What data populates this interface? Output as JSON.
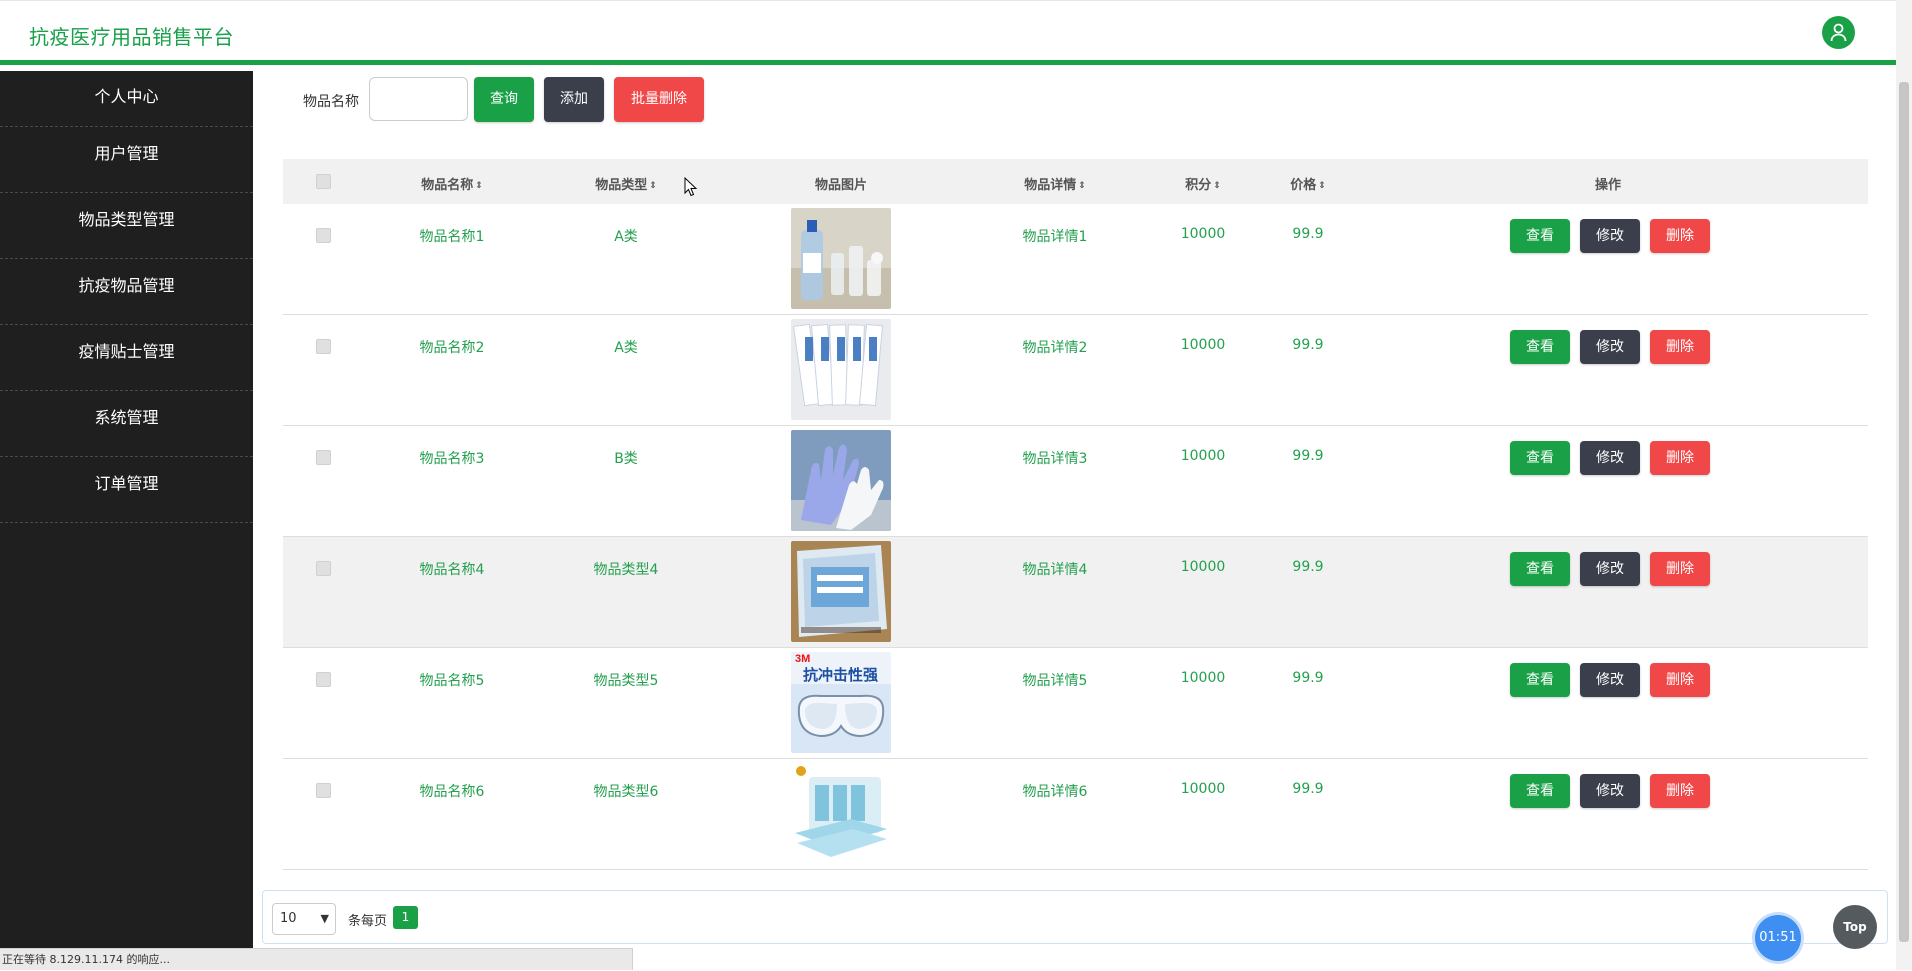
{
  "header": {
    "title": "抗疫医疗用品销售平台"
  },
  "sidebar": {
    "items": [
      {
        "label": "个人中心"
      },
      {
        "label": "用户管理"
      },
      {
        "label": "物品类型管理"
      },
      {
        "label": "抗疫物品管理"
      },
      {
        "label": "疫情贴士管理"
      },
      {
        "label": "系统管理"
      },
      {
        "label": "订单管理"
      }
    ]
  },
  "toolbar": {
    "search_label": "物品名称",
    "search_value": "",
    "query_label": "查询",
    "add_label": "添加",
    "batch_delete_label": "批量删除"
  },
  "table": {
    "columns": [
      "物品名称",
      "物品类型",
      "物品图片",
      "物品详情",
      "积分",
      "价格",
      "操作"
    ],
    "rows": [
      {
        "name": "物品名称1",
        "type": "A类",
        "detail": "物品详情1",
        "points": "10000",
        "price": "99.9",
        "image": "hand-sanitizer-image"
      },
      {
        "name": "物品名称2",
        "type": "A类",
        "detail": "物品详情2",
        "points": "10000",
        "price": "99.9",
        "image": "swab-packets-image"
      },
      {
        "name": "物品名称3",
        "type": "B类",
        "detail": "物品详情3",
        "points": "10000",
        "price": "99.9",
        "image": "gloves-image"
      },
      {
        "name": "物品名称4",
        "type": "物品类型4",
        "detail": "物品详情4",
        "points": "10000",
        "price": "99.9",
        "image": "bagged-masks-image"
      },
      {
        "name": "物品名称5",
        "type": "物品类型5",
        "detail": "物品详情5",
        "points": "10000",
        "price": "99.9",
        "image": "goggles-image"
      },
      {
        "name": "物品名称6",
        "type": "物品类型6",
        "detail": "物品详情6",
        "points": "10000",
        "price": "99.9",
        "image": "surgical-masks-image"
      }
    ],
    "actions": {
      "view": "查看",
      "edit": "修改",
      "delete": "删除"
    }
  },
  "image_text": {
    "goggles_brand": "3M",
    "goggles_caption": "抗冲击性强"
  },
  "pagination": {
    "page_size": "10",
    "per_page_label": "条每页",
    "current_page": "1"
  },
  "timer": "01:51",
  "top_button": "Top",
  "status_bar": "正在等待 8.129.11.174 的响应...",
  "colors": {
    "accent": "#1aa148",
    "dark_button": "#3a3f4b",
    "danger": "#f04848",
    "sidebar": "#1f1f1f"
  }
}
